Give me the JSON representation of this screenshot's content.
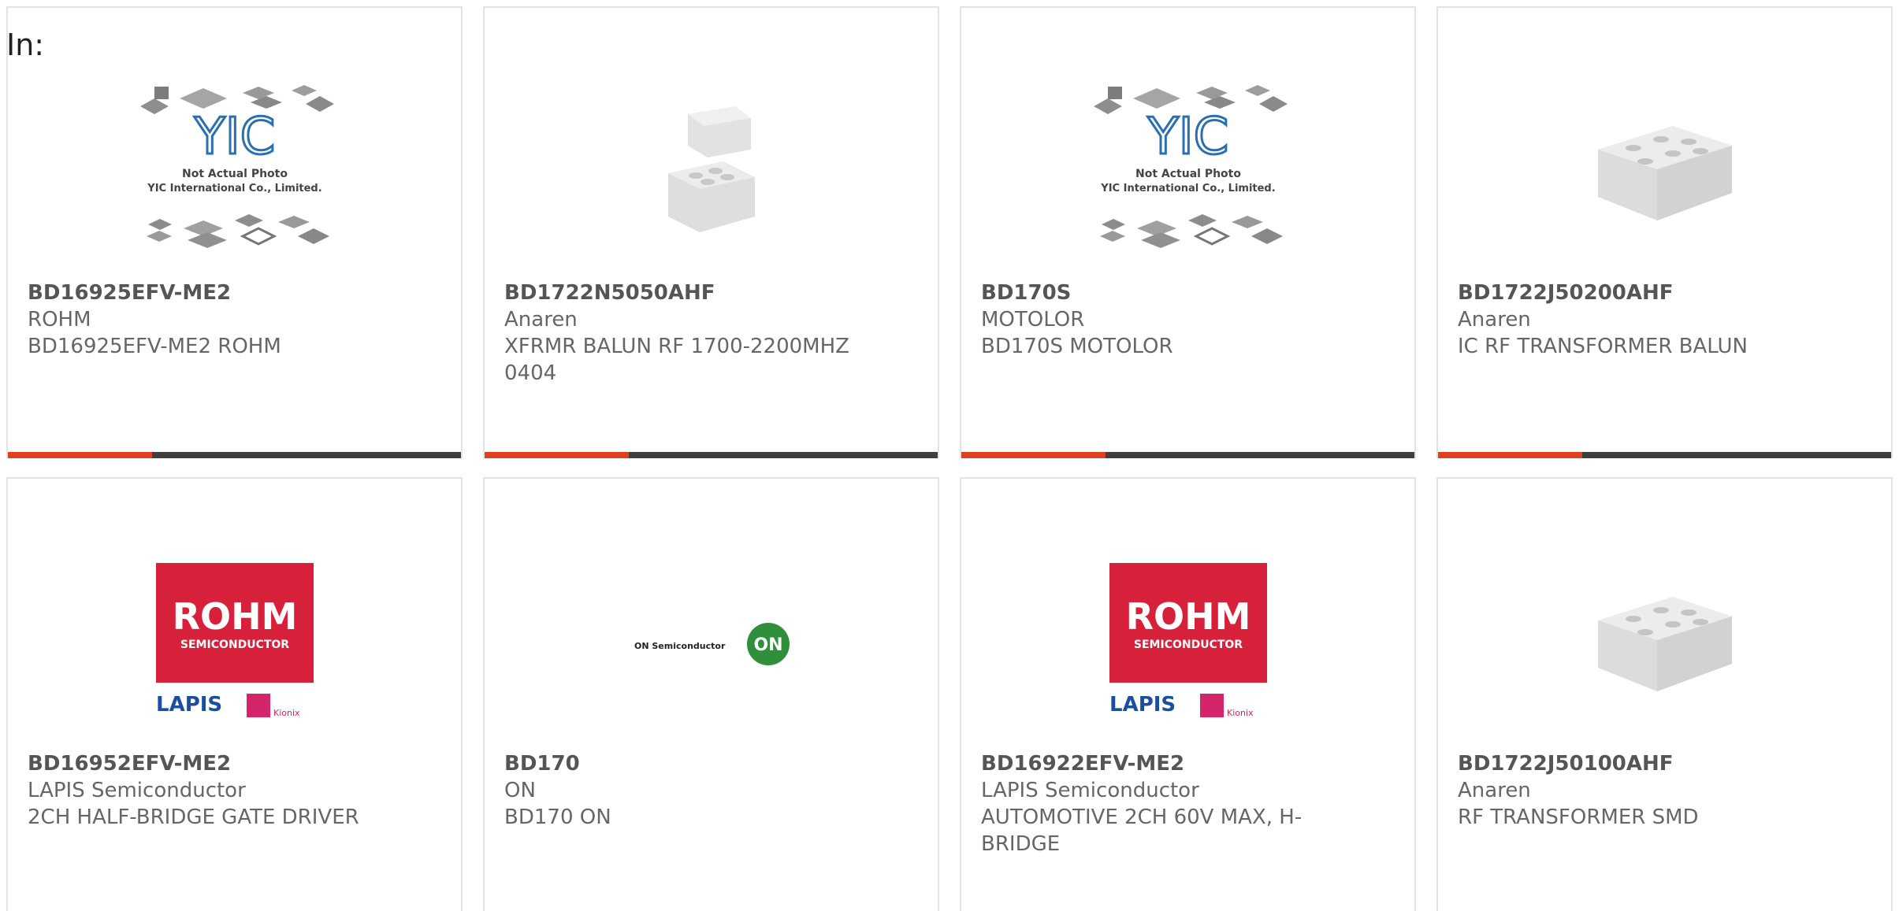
{
  "search": {
    "label": "In:"
  },
  "products": [
    {
      "part": "BD16925EFV-ME2",
      "maker": "ROHM",
      "desc": "BD16925EFV-ME2 ROHM",
      "image": "yic-placeholder",
      "placeholder_text_1": "Not Actual Photo",
      "placeholder_text_2": "YIC International Co., Limited.",
      "placeholder_logo": "YIC"
    },
    {
      "part": "BD1722N5050AHF",
      "maker": "Anaren",
      "desc": "XFRMR BALUN RF 1700-2200MHZ 0404",
      "image": "chip-stack"
    },
    {
      "part": "BD170S",
      "maker": "MOTOLOR",
      "desc": "BD170S MOTOLOR",
      "image": "yic-placeholder",
      "placeholder_text_1": "Not Actual Photo",
      "placeholder_text_2": "YIC International Co., Limited.",
      "placeholder_logo": "YIC"
    },
    {
      "part": "BD1722J50200AHF",
      "maker": "Anaren",
      "desc": "IC RF TRANSFORMER BALUN",
      "image": "balun-block"
    },
    {
      "part": "BD16952EFV-ME2",
      "maker": "LAPIS Semiconductor",
      "desc": "2CH HALF-BRIDGE GATE DRIVER",
      "image": "rohm-logo",
      "logo_text_1": "ROHM",
      "logo_text_2": "SEMICONDUCTOR",
      "logo_text_3": "LAPIS",
      "logo_text_4": "Kionix"
    },
    {
      "part": "BD170",
      "maker": "ON",
      "desc": "BD170 ON",
      "image": "on-logo",
      "logo_text_1": "ON Semiconductor",
      "logo_text_2": "ON"
    },
    {
      "part": "BD16922EFV-ME2",
      "maker": "LAPIS Semiconductor",
      "desc": "AUTOMOTIVE 2CH 60V MAX, H-BRIDGE",
      "image": "rohm-logo",
      "logo_text_1": "ROHM",
      "logo_text_2": "SEMICONDUCTOR",
      "logo_text_3": "LAPIS",
      "logo_text_4": "Kionix"
    },
    {
      "part": "BD1722J50100AHF",
      "maker": "Anaren",
      "desc": "RF TRANSFORMER SMD",
      "image": "balun-block"
    }
  ],
  "colors": {
    "accent": "#e0401f",
    "bar": "#3f3f3f",
    "rohm_red": "#d7213a",
    "lapis_blue": "#1c4ea0",
    "on_green": "#2f8f3a",
    "yic_blue": "#2a6fb0"
  }
}
